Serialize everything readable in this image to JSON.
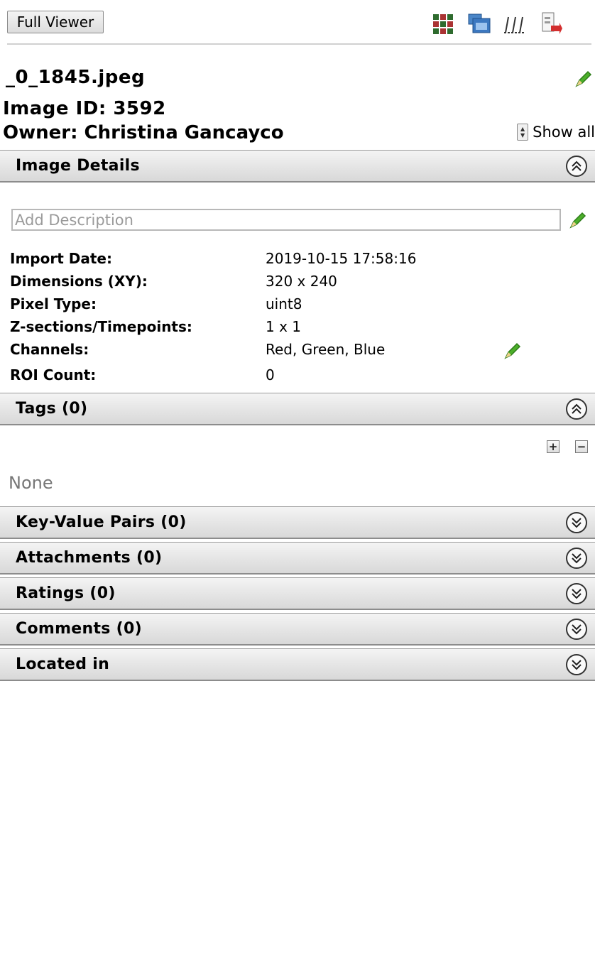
{
  "toolbar": {
    "full_viewer_label": "Full Viewer",
    "icons": [
      "grid-view-icon",
      "open-folder-icon",
      "measure-icon",
      "export-icon"
    ]
  },
  "header": {
    "file_name": "_0_1845.jpeg",
    "image_id": "Image ID: 3592",
    "owner": "Owner: Christina Gancayco",
    "show_all_label": "Show all"
  },
  "sections": {
    "image_details": {
      "title": "Image Details",
      "description_placeholder": "Add Description",
      "rows": [
        {
          "key": "Import Date:",
          "value": "2019-10-15 17:58:16"
        },
        {
          "key": "Dimensions (XY):",
          "value": "320 x 240"
        },
        {
          "key": "Pixel Type:",
          "value": "uint8"
        },
        {
          "key": "Z-sections/Timepoints:",
          "value": "1 x 1"
        },
        {
          "key": "Channels:",
          "value": "Red, Green, Blue"
        },
        {
          "key": "ROI Count:",
          "value": "0"
        }
      ]
    },
    "tags": {
      "title": "Tags (0)",
      "empty_text": "None",
      "add_label": "+",
      "remove_label": "−"
    },
    "key_value_pairs": {
      "title": "Key-Value Pairs (0)"
    },
    "attachments": {
      "title": "Attachments (0)"
    },
    "ratings": {
      "title": "Ratings (0)"
    },
    "comments": {
      "title": "Comments (0)"
    },
    "located_in": {
      "title": "Located in"
    }
  },
  "colors": {
    "pencil_green": "#4caf2a",
    "section_bg_top": "#f4f4f4",
    "section_bg_bottom": "#d8d8d8"
  }
}
